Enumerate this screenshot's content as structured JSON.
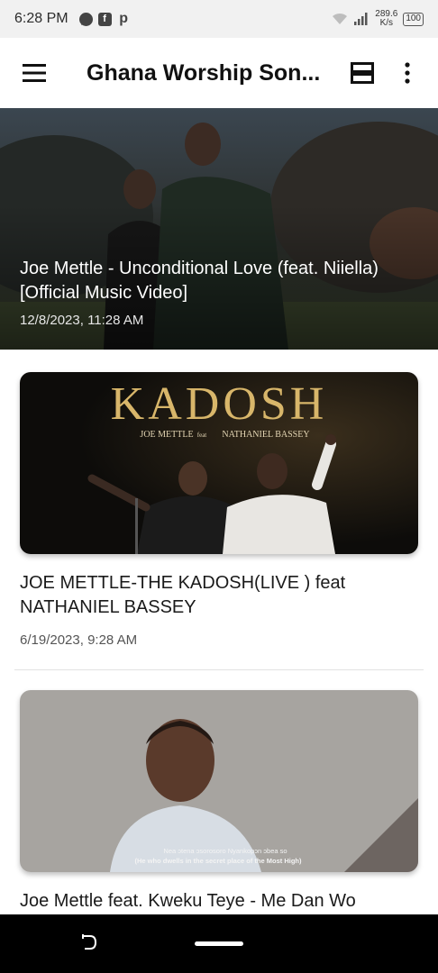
{
  "status_bar": {
    "time": "6:28 PM",
    "notifications": [
      "chat-icon",
      "facebook-icon",
      "p-icon"
    ],
    "speed_value": "289.6",
    "speed_unit": "K/s",
    "battery": "100"
  },
  "app_bar": {
    "title": "Ghana Worship Son...",
    "menu_icon": "menu-icon",
    "layout_icon": "layout-toggle-icon",
    "more_icon": "more-vert-icon"
  },
  "feed": {
    "featured": {
      "title": "Joe Mettle - Unconditional Love (feat. Niiella) [Official Music Video]",
      "date": "12/8/2023, 11:28 AM"
    },
    "items": [
      {
        "thumb_heading": "KADOSH",
        "thumb_sub": "JOE METTLE",
        "thumb_feat": "feat",
        "thumb_sub2": "NATHANIEL BASSEY",
        "title": "JOE METTLE-THE KADOSH(LIVE ) feat NATHANIEL BASSEY",
        "date": "6/19/2023, 9:28 AM"
      },
      {
        "subtitle_line1": "Nea ɔtena ɔsorosoro Nyankopɔn ɔbea so",
        "subtitle_line2": "(He who dwells in the secret place of the Most High)",
        "title": "Joe Mettle feat. Kweku Teye - Me Dan Wo"
      }
    ]
  },
  "colors": {
    "app_bar_bg": "#ffffff",
    "status_bar_bg": "#f1f1f1",
    "nav_bar_bg": "#000000",
    "kadosh_gold": "#d8b66a"
  }
}
